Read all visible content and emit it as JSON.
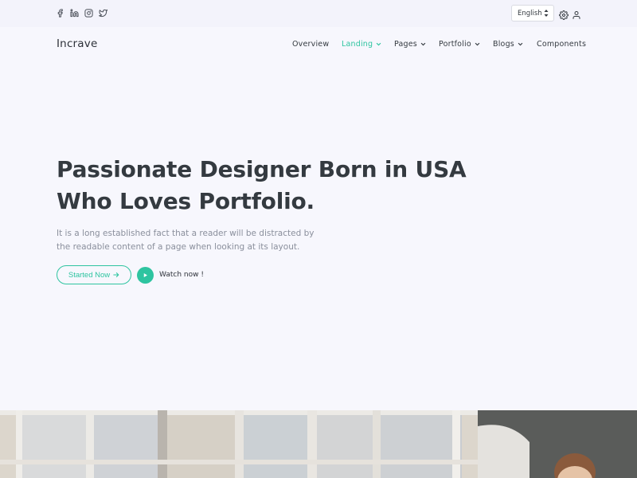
{
  "topbar": {
    "social": [
      {
        "name": "facebook-icon"
      },
      {
        "name": "linkedin-icon"
      },
      {
        "name": "instagram-icon"
      },
      {
        "name": "twitter-icon"
      }
    ],
    "language": "English",
    "settings_icon": "gear-icon",
    "user_icon": "user-icon"
  },
  "nav": {
    "brand": "Incrave",
    "items": [
      {
        "label": "Overview",
        "dropdown": false,
        "active": false
      },
      {
        "label": "Landing",
        "dropdown": true,
        "active": true
      },
      {
        "label": "Pages",
        "dropdown": true,
        "active": false
      },
      {
        "label": "Portfolio",
        "dropdown": true,
        "active": false
      },
      {
        "label": "Blogs",
        "dropdown": true,
        "active": false
      },
      {
        "label": "Components",
        "dropdown": false,
        "active": false
      }
    ]
  },
  "hero": {
    "title_line1": "Passionate Designer Born in USA",
    "title_line2": "Who Loves Portfolio.",
    "text": "It is a long established fact that a reader will be distracted by the readable content of a page when looking at its layout.",
    "primary_button": "Started Now",
    "watch_label": "Watch now !"
  },
  "colors": {
    "accent": "#2ec4a0",
    "background": "#f7f7fd",
    "text": "#343a40",
    "muted": "#8a8f9c"
  }
}
